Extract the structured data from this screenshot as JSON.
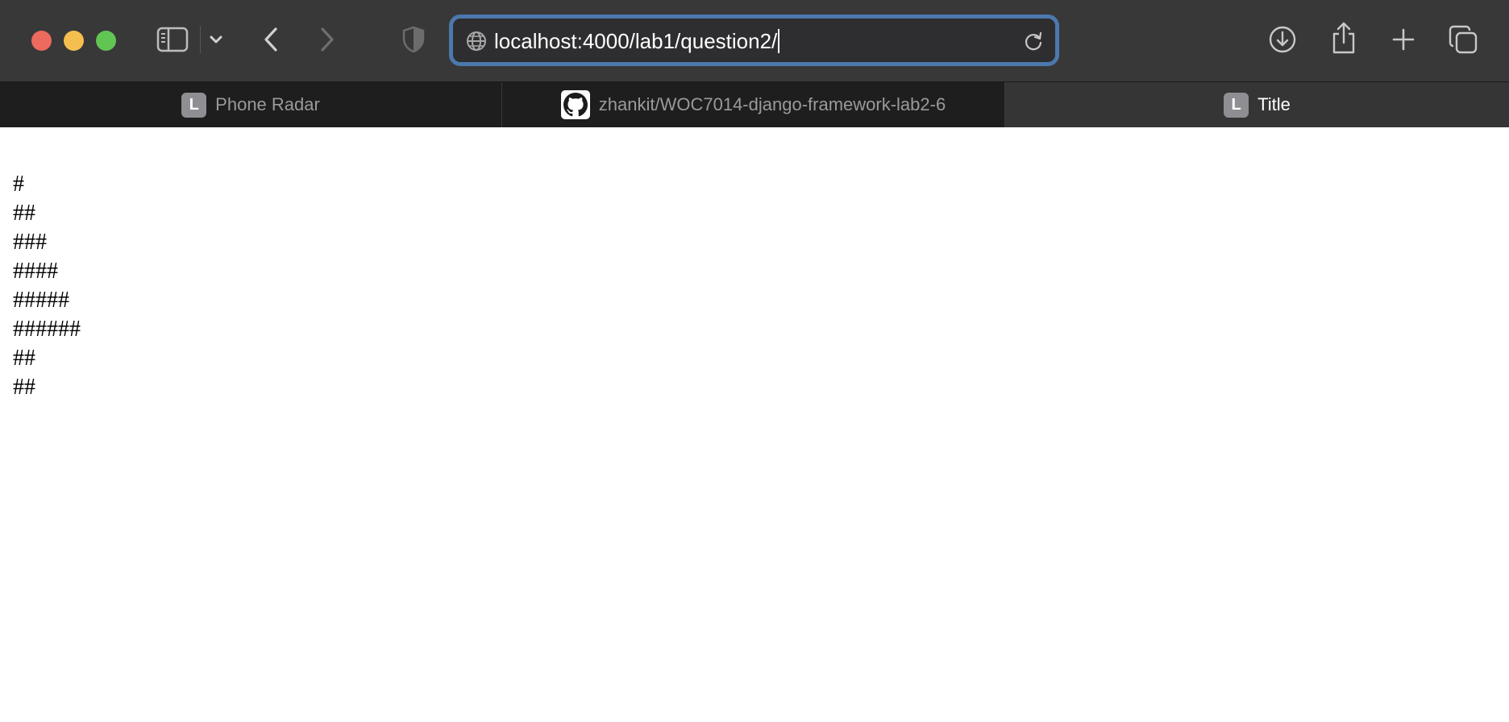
{
  "window": {
    "traffic_lights": {
      "close_color": "#ed6a5e",
      "minimize_color": "#f5bf4f",
      "maximize_color": "#61c554"
    }
  },
  "toolbar": {
    "icons": {
      "sidebar": "sidebar-icon",
      "sidebar_menu": "chevron-down-icon",
      "back": "chevron-left-icon",
      "forward": "chevron-right-icon",
      "privacy": "shield-icon",
      "download": "download-icon",
      "share": "share-icon",
      "new_tab": "plus-icon",
      "tab_overview": "tabs-overview-icon"
    },
    "address_bar": {
      "url": "localhost:4000/lab1/question2/",
      "focus_color": "#4c78ad"
    }
  },
  "tabs": [
    {
      "label": "Phone Radar",
      "favicon_letter": "L",
      "active": false
    },
    {
      "label": "zhankit/WOC7014-django-framework-lab2-6",
      "favicon": "github-icon",
      "active": false
    },
    {
      "label": "Title",
      "favicon_letter": "L",
      "active": true
    }
  ],
  "page": {
    "lines": [
      "#",
      "##",
      "###",
      "####",
      "#####",
      "######",
      "##",
      "##"
    ]
  }
}
